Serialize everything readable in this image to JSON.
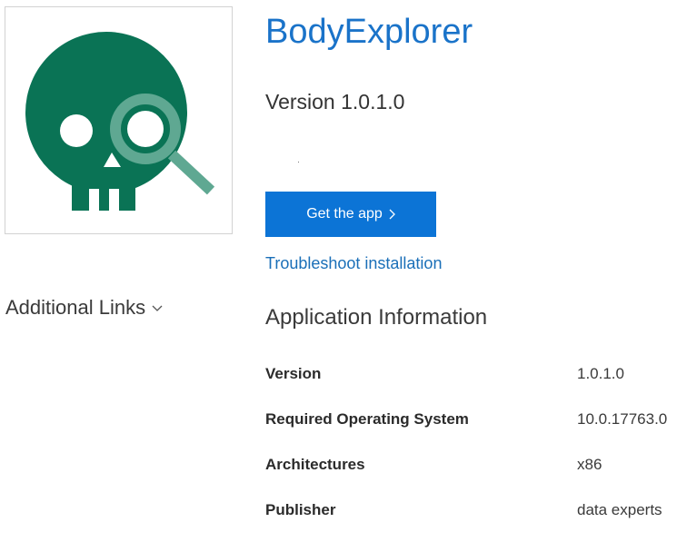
{
  "app": {
    "title": "BodyExplorer",
    "version_line": "Version 1.0.1.0",
    "logo_icon": "skull-magnifier-icon",
    "brand_color": "#0A7355",
    "accent_color": "#0C74D6"
  },
  "sidebar": {
    "additional_links_label": "Additional Links"
  },
  "actions": {
    "get_app_label": "Get the app",
    "troubleshoot_label": "Troubleshoot installation"
  },
  "info": {
    "heading": "Application Information",
    "rows": [
      {
        "label": "Version",
        "value": "1.0.1.0"
      },
      {
        "label": "Required Operating System",
        "value": "10.0.17763.0"
      },
      {
        "label": "Architectures",
        "value": "x86"
      },
      {
        "label": "Publisher",
        "value": "data experts"
      }
    ]
  }
}
